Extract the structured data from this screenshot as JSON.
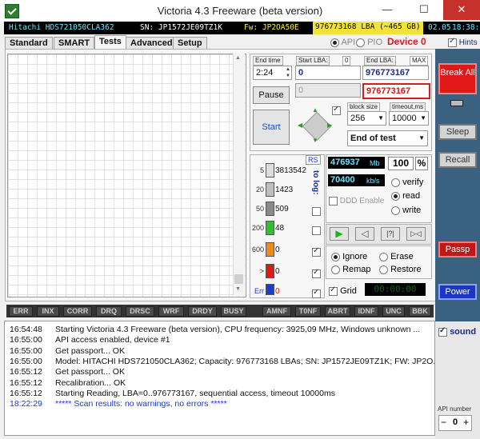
{
  "window": {
    "title": "Victoria 4.3 Freeware (beta version)",
    "minimize": "—",
    "maximize": "☐",
    "close": "✕"
  },
  "info": {
    "model": "Hitachi HDS721050CLA362",
    "serial": "SN: JP1572JE09TZ1K",
    "firmware": "Fw: JP2OA50E",
    "capacity": "976773168 LBA (~465 GB)",
    "date": "02.05",
    "time": "18:38:1"
  },
  "mode": {
    "api": "API",
    "pio": "PIO",
    "device": "Device 0",
    "hints": "Hints"
  },
  "tabs": [
    "Standard",
    "SMART",
    "Tests",
    "Advanced",
    "Setup"
  ],
  "range": {
    "end_time_label": "End time",
    "end_time_value": "2:24",
    "start_lba_label": "Start LBA:",
    "start_lba_value": "0",
    "start_lba_small": "0",
    "end_lba_label": "End LBA:",
    "end_lba_max": "MAX",
    "end_lba_value": "976773167",
    "end_lba_current": "976773167",
    "pause": "Pause",
    "start": "Start",
    "block_size_label": "block size",
    "block_size_value": "256",
    "timeout_label": "timeout,ms",
    "timeout_value": "10000",
    "end_of_test": "End of test"
  },
  "counters": {
    "rs": "RS",
    "to_log": "to log:",
    "rows": [
      {
        "thr": "5",
        "value": "3813542",
        "color": "#dddddd"
      },
      {
        "thr": "20",
        "value": "1423",
        "color": "#bfbfbf"
      },
      {
        "thr": "50",
        "value": "509",
        "color": "#8a8a8a"
      },
      {
        "thr": "200",
        "value": "48",
        "color": "#2fc02f"
      },
      {
        "thr": "600",
        "value": "0",
        "color": "#f08a1c"
      },
      {
        "thr": ">",
        "value": "0",
        "color": "#e01818"
      },
      {
        "thr": "Err",
        "value": "0",
        "color": "#1a3fd0"
      }
    ]
  },
  "progress": {
    "mb_value": "476937",
    "mb_unit": "Mb",
    "percent": "100",
    "percent_sign": "%",
    "speed_value": "70400",
    "speed_unit": "kb/s",
    "ddd_enable": "DDD Enable",
    "verify": "verify",
    "read": "read",
    "write": "write",
    "ignore": "Ignore",
    "erase": "Erase",
    "remap": "Remap",
    "restore": "Restore",
    "grid": "Grid",
    "grid_time": "00:00:00"
  },
  "side_buttons": {
    "break_all": "Break All",
    "sleep": "Sleep",
    "recall": "Recall",
    "passp": "Passp",
    "power": "Power",
    "sound": "sound",
    "api_number_label": "API number",
    "api_number_value": "0",
    "minus": "−",
    "plus": "+"
  },
  "status_flags": [
    "ERR",
    "INX",
    "CORR",
    "DRQ",
    "DRSC",
    "WRF",
    "DRDY",
    "BUSY",
    "AMNF",
    "T0NF",
    "ABRT",
    "IDNF",
    "UNC",
    "BBK"
  ],
  "log": [
    {
      "time": "16:54:48",
      "msg": "Starting Victoria 4.3 Freeware (beta version), CPU frequency: 3925,09 MHz, Windows unknown ...",
      "color": "#111111"
    },
    {
      "time": "16:55:00",
      "msg": "API access enabled, device #1",
      "color": "#111111"
    },
    {
      "time": "16:55:00",
      "msg": "Get passport... OK",
      "color": "#111111"
    },
    {
      "time": "16:55:00",
      "msg": "Model: HITACHI HDS721050CLA362; Capacity: 976773168 LBAs; SN: JP1572JE09TZ1K; FW: JP2O...",
      "color": "#111111"
    },
    {
      "time": "16:55:12",
      "msg": "Get passport... OK",
      "color": "#111111"
    },
    {
      "time": "16:55:12",
      "msg": "Recalibration... OK",
      "color": "#111111"
    },
    {
      "time": "16:55:12",
      "msg": "Starting Reading, LBA=0..976773167, sequential access, timeout 10000ms",
      "color": "#111111"
    },
    {
      "time": "18:22:29",
      "msg": "***** Scan results: no warnings, no errors *****",
      "color": "#1a35d8"
    }
  ]
}
